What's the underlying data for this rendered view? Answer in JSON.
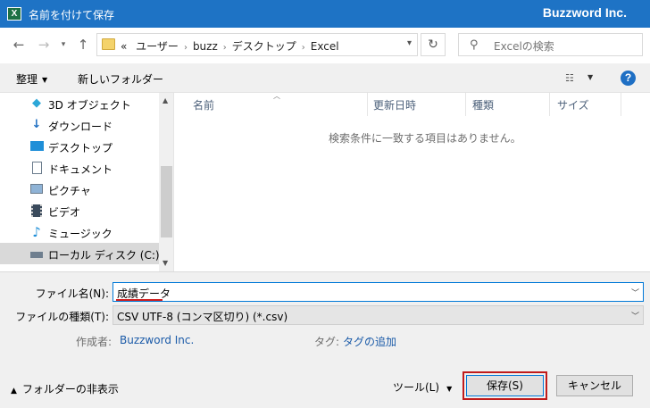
{
  "window": {
    "title": "名前を付けて保存",
    "brand": "Buzzword Inc.",
    "app_icon_letter": "X"
  },
  "address": {
    "prefix": "«",
    "crumbs": [
      "ユーザー",
      "buzz",
      "デスクトップ",
      "Excel"
    ],
    "search_placeholder": "Excelの検索"
  },
  "toolbar": {
    "organize": "整理",
    "new_folder": "新しいフォルダー",
    "help": "?"
  },
  "nav": {
    "items": [
      {
        "label": "3D オブジェクト",
        "icon": "cube-icon"
      },
      {
        "label": "ダウンロード",
        "icon": "download-arrow-icon"
      },
      {
        "label": "デスクトップ",
        "icon": "desktop-icon"
      },
      {
        "label": "ドキュメント",
        "icon": "document-icon"
      },
      {
        "label": "ピクチャ",
        "icon": "picture-icon"
      },
      {
        "label": "ビデオ",
        "icon": "video-icon"
      },
      {
        "label": "ミュージック",
        "icon": "music-note-icon"
      },
      {
        "label": "ローカル ディスク (C:)",
        "icon": "drive-icon",
        "selected": true
      }
    ]
  },
  "filelist": {
    "columns": [
      "名前",
      "更新日時",
      "種類",
      "サイズ"
    ],
    "empty_message": "検索条件に一致する項目はありません。"
  },
  "form": {
    "filename_label": "ファイル名(N):",
    "filename_value": "成績データ",
    "filetype_label": "ファイルの種類(T):",
    "filetype_value": "CSV UTF-8 (コンマ区切り) (*.csv)",
    "author_label": "作成者:",
    "author_value": "Buzzword Inc.",
    "tags_label": "タグ:",
    "tags_value": "タグの追加"
  },
  "footer": {
    "hide_folders": "フォルダーの非表示",
    "tools": "ツール(L)",
    "save": "保存(S)",
    "cancel": "キャンセル"
  },
  "colors": {
    "titlebar": "#1e73c5",
    "highlight_box": "#c01b1b",
    "link": "#1a5aa8"
  }
}
